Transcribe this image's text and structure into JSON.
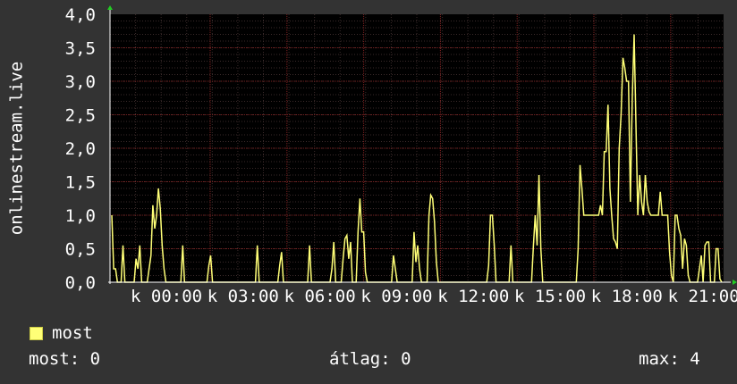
{
  "chart_data": {
    "type": "line",
    "ylabel": "onlinestream.live",
    "ylim": [
      0,
      4
    ],
    "yticks": [
      "0,0",
      "0,5",
      "1,0",
      "1,5",
      "2,0",
      "2,5",
      "3,0",
      "3,5",
      "4,0"
    ],
    "xticks": [
      "k 00:00",
      "k 03:00",
      "k 06:00",
      "k 09:00",
      "k 12:00",
      "k 15:00",
      "k 18:00",
      "k 21:00"
    ],
    "grid": true,
    "series": [
      {
        "name": "most",
        "color": "#ffff77",
        "values": [
          1.0,
          0.2,
          0.2,
          0,
          0,
          0,
          0.55,
          0,
          0,
          0,
          0,
          0,
          0,
          0.35,
          0.2,
          0.55,
          0,
          0,
          0,
          0,
          0.2,
          0.4,
          1.15,
          0.8,
          1.0,
          1.4,
          1.1,
          0.55,
          0.2,
          0,
          0,
          0,
          0,
          0,
          0,
          0,
          0,
          0,
          0.55,
          0,
          0,
          0,
          0,
          0,
          0,
          0,
          0,
          0,
          0,
          0,
          0,
          0,
          0.25,
          0.4,
          0,
          0,
          0,
          0,
          0,
          0,
          0,
          0,
          0,
          0,
          0,
          0,
          0,
          0,
          0,
          0,
          0,
          0,
          0,
          0,
          0,
          0,
          0,
          0,
          0.55,
          0,
          0,
          0,
          0,
          0,
          0,
          0,
          0,
          0,
          0,
          0,
          0.25,
          0.45,
          0,
          0,
          0,
          0,
          0,
          0,
          0,
          0,
          0,
          0,
          0,
          0,
          0,
          0,
          0.55,
          0,
          0,
          0,
          0,
          0,
          0,
          0,
          0,
          0,
          0,
          0,
          0.2,
          0.6,
          0,
          0,
          0,
          0,
          0.35,
          0.65,
          0.7,
          0.35,
          0.6,
          0,
          0,
          0,
          0.75,
          1.25,
          0.75,
          0.75,
          0.15,
          0,
          0,
          0,
          0,
          0,
          0,
          0,
          0,
          0,
          0,
          0,
          0,
          0,
          0,
          0.4,
          0.2,
          0,
          0,
          0,
          0,
          0,
          0,
          0,
          0,
          0,
          0.75,
          0.3,
          0.55,
          0.2,
          0,
          0,
          0,
          0,
          1.0,
          1.3,
          1.25,
          0.9,
          0.3,
          0,
          0,
          0,
          0,
          0,
          0,
          0,
          0,
          0,
          0,
          0,
          0,
          0,
          0,
          0,
          0,
          0,
          0,
          0,
          0,
          0,
          0,
          0,
          0,
          0,
          0,
          0,
          0.25,
          1.0,
          1.0,
          0.55,
          0,
          0,
          0,
          0,
          0,
          0,
          0,
          0,
          0.55,
          0,
          0,
          0,
          0,
          0,
          0,
          0,
          0,
          0,
          0,
          0,
          0.55,
          1.0,
          0.55,
          1.6,
          0.5,
          0,
          0,
          0,
          0,
          0,
          0,
          0,
          0,
          0,
          0,
          0,
          0,
          0,
          0,
          0,
          0,
          0,
          0,
          0,
          0.5,
          1.75,
          1.4,
          1.0,
          1.0,
          1.0,
          1.0,
          1.0,
          1.0,
          1.0,
          1.0,
          1.0,
          1.15,
          1.0,
          1.95,
          1.95,
          2.65,
          1.4,
          1.0,
          0.65,
          0.6,
          0.5,
          2.0,
          2.5,
          3.35,
          3.2,
          3.0,
          3.0,
          1.2,
          2.75,
          3.7,
          2.3,
          1.0,
          1.6,
          1.2,
          1.0,
          1.6,
          1.2,
          1.05,
          1.0,
          1.0,
          1.0,
          1.0,
          1.0,
          1.35,
          1.0,
          1.0,
          1.0,
          1.0,
          0.45,
          0.1,
          0,
          1.0,
          1.0,
          0.8,
          0.7,
          0.2,
          0.65,
          0.55,
          0.1,
          0,
          0,
          0,
          0,
          0,
          0.2,
          0.4,
          0,
          0.55,
          0.6,
          0.6,
          0,
          0,
          0,
          0.5,
          0.5,
          0.05,
          0
        ]
      }
    ]
  },
  "legend": {
    "label": "most"
  },
  "stats": {
    "current": "most: 0",
    "average": "átlag: 0",
    "max": "max: 4"
  }
}
